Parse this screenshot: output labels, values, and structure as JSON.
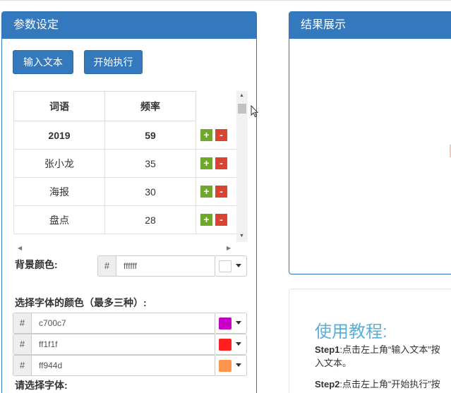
{
  "params_panel": {
    "title": "参数设定",
    "input_text_button": "输入文本",
    "start_button": "开始执行",
    "table": {
      "headers": [
        "词语",
        "频率"
      ],
      "rows": [
        {
          "word": "2019",
          "freq": "59"
        },
        {
          "word": "张小龙",
          "freq": "35"
        },
        {
          "word": "海报",
          "freq": "30"
        },
        {
          "word": "盘点",
          "freq": "28"
        }
      ],
      "plus_label": "+",
      "minus_label": "-"
    },
    "bg_color": {
      "label": "背景颜色:",
      "hash": "#",
      "value": "ffffff",
      "swatch_color": "#ffffff"
    },
    "font_colors": {
      "label": "选择字体的颜色（最多三种）:",
      "items": [
        {
          "hash": "#",
          "value": "c700c7",
          "swatch_color": "#c700c7"
        },
        {
          "hash": "#",
          "value": "ff1f1f",
          "swatch_color": "#ff1f1f"
        },
        {
          "hash": "#",
          "value": "ff944d",
          "swatch_color": "#ff944d"
        }
      ]
    },
    "font_select_label": "请选择字体:"
  },
  "result_panel": {
    "title": "结果展示"
  },
  "tutorial": {
    "title": "使用教程:",
    "step1_prefix": "Step1",
    "step1_text": ":点击左上角“输入文本”按",
    "step1_cont": "入文本。",
    "step2_prefix": "Step2",
    "step2_text": ":点击左上角“开始执行”按"
  },
  "colors": {
    "header_blue": "#3478bd",
    "plus_green": "#6ea82a",
    "minus_red": "#d9432f",
    "tutorial_title": "#5ab0d8"
  }
}
